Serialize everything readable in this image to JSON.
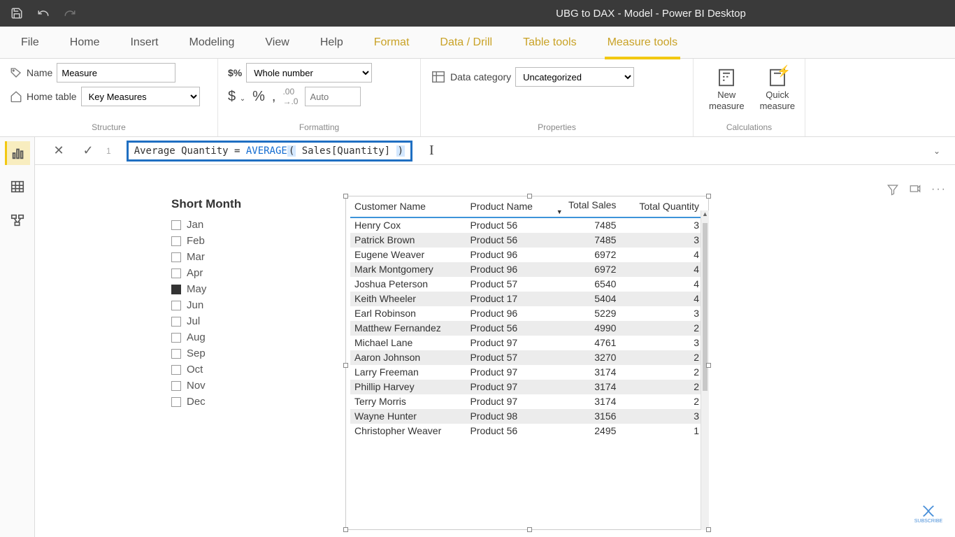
{
  "titlebar": {
    "title": "UBG to DAX - Model - Power BI Desktop"
  },
  "ribbon": {
    "tabs": [
      "File",
      "Home",
      "Insert",
      "Modeling",
      "View",
      "Help",
      "Format",
      "Data / Drill",
      "Table tools",
      "Measure tools"
    ],
    "active": 9,
    "context_from": 6
  },
  "structure": {
    "name_label": "Name",
    "name_value": "Measure",
    "home_table_label": "Home table",
    "home_table_value": "Key Measures",
    "group": "Structure"
  },
  "formatting": {
    "format_value": "Whole number",
    "auto_placeholder": "Auto",
    "group": "Formatting"
  },
  "properties": {
    "cat_label": "Data category",
    "cat_value": "Uncategorized",
    "group": "Properties"
  },
  "calculations": {
    "new_measure": "New\nmeasure",
    "quick_measure": "Quick\nmeasure",
    "group": "Calculations"
  },
  "formula": {
    "prefix": "Average Quantity = ",
    "func": "AVERAGE",
    "arg": " Sales[Quantity] ",
    "line": "1"
  },
  "slicer": {
    "title": "Short Month",
    "items": [
      {
        "label": "Jan",
        "checked": false
      },
      {
        "label": "Feb",
        "checked": false
      },
      {
        "label": "Mar",
        "checked": false
      },
      {
        "label": "Apr",
        "checked": false
      },
      {
        "label": "May",
        "checked": true
      },
      {
        "label": "Jun",
        "checked": false
      },
      {
        "label": "Jul",
        "checked": false
      },
      {
        "label": "Aug",
        "checked": false
      },
      {
        "label": "Sep",
        "checked": false
      },
      {
        "label": "Oct",
        "checked": false
      },
      {
        "label": "Nov",
        "checked": false
      },
      {
        "label": "Dec",
        "checked": false
      }
    ]
  },
  "table": {
    "columns": [
      "Customer Name",
      "Product Name",
      "Total Sales",
      "Total Quantity"
    ],
    "rows": [
      [
        "Henry Cox",
        "Product 56",
        "7485",
        "3"
      ],
      [
        "Patrick Brown",
        "Product 56",
        "7485",
        "3"
      ],
      [
        "Eugene Weaver",
        "Product 96",
        "6972",
        "4"
      ],
      [
        "Mark Montgomery",
        "Product 96",
        "6972",
        "4"
      ],
      [
        "Joshua Peterson",
        "Product 57",
        "6540",
        "4"
      ],
      [
        "Keith Wheeler",
        "Product 17",
        "5404",
        "4"
      ],
      [
        "Earl Robinson",
        "Product 96",
        "5229",
        "3"
      ],
      [
        "Matthew Fernandez",
        "Product 56",
        "4990",
        "2"
      ],
      [
        "Michael Lane",
        "Product 97",
        "4761",
        "3"
      ],
      [
        "Aaron Johnson",
        "Product 57",
        "3270",
        "2"
      ],
      [
        "Larry Freeman",
        "Product 97",
        "3174",
        "2"
      ],
      [
        "Phillip Harvey",
        "Product 97",
        "3174",
        "2"
      ],
      [
        "Terry Morris",
        "Product 97",
        "3174",
        "2"
      ],
      [
        "Wayne Hunter",
        "Product 98",
        "3156",
        "3"
      ],
      [
        "Christopher Weaver",
        "Product 56",
        "2495",
        "1"
      ]
    ]
  },
  "watermark": "SUBSCRIBE"
}
